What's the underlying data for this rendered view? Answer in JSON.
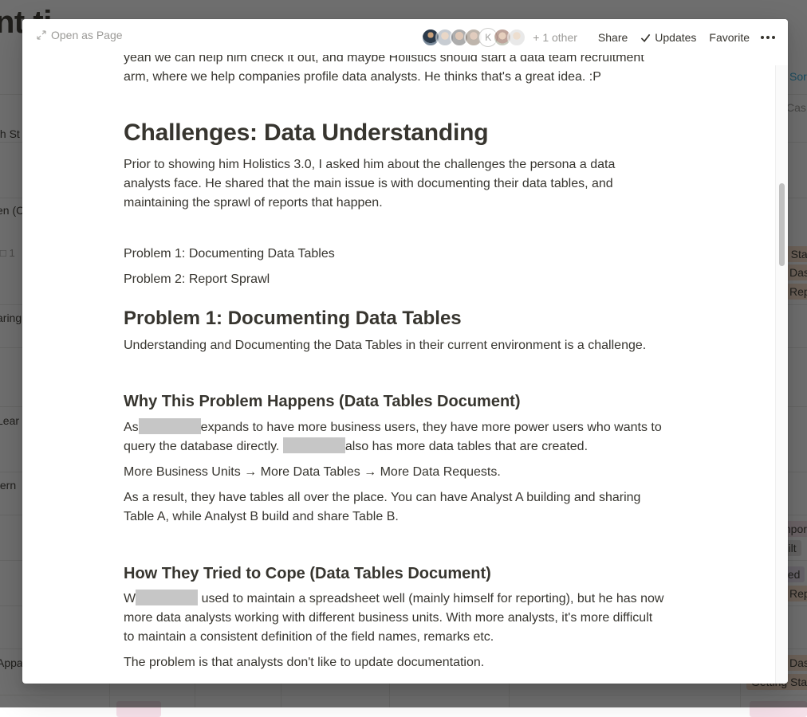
{
  "background_page": {
    "title_fragment": "nt      ti",
    "left_cells": [
      "th St",
      "en (C",
      "aring",
      "Lear",
      "tern",
      "Appa"
    ],
    "comment_count": "1",
    "right_cells": {
      "sort_label": "Sor",
      "case_label": "Cas",
      "tags": [
        "g Sta",
        "Das",
        "Rep",
        "mpor",
        "Filt",
        "ded",
        "Rep",
        "Das",
        "Getting Sta"
      ]
    }
  },
  "modal": {
    "open_as_page_label": "Open as Page",
    "collaborators": {
      "avatars": [
        "avatar-1",
        "avatar-2",
        "avatar-3",
        "avatar-4",
        "K",
        "avatar-6",
        "avatar-7"
      ],
      "others_label": "+ 1 other"
    },
    "actions": {
      "share": "Share",
      "updates": "Updates",
      "favorite": "Favorite"
    },
    "body": {
      "intro_line1": "yeah we can help him check it out, and maybe Holistics should start a data team recruitment",
      "intro_line2": "arm, where we help companies profile data analysts. He thinks that's a great idea. :P",
      "h_challenges": "Challenges: Data Understanding",
      "challenges_p1": "Prior to showing him Holistics 3.0, I asked him about the challenges the persona a data",
      "challenges_p2": "analysts face. He shared that the main issue is with documenting their data tables, and",
      "challenges_p3": "maintaining the sprawl of reports that happen.",
      "problem_list": [
        "Problem 1: Documenting Data Tables",
        "Problem 2: Report Sprawl"
      ],
      "h_problem1": "Problem 1: Documenting Data Tables",
      "problem1_p": "Understanding and Documenting the Data Tables in their current environment is a challenge.",
      "h_why": "Why This Problem Happens (Data Tables Document)",
      "why_p1_a": "As",
      "why_p1_b": "expands to have more business users, they have more power users who wants to",
      "why_p2_a": "query the database directly.",
      "why_p2_b": "also has more data tables that are created.",
      "why_flow": "More Business Units → More Data Tables  → More Data Requests.",
      "why_result1": "As a result, they have tables all over the place. You can have Analyst A building and sharing",
      "why_result2": "Table A, while Analyst B build and share Table B.",
      "h_cope": "How They Tried to Cope (Data Tables Document)",
      "cope_p1_a": "W",
      "cope_p1_b": "used to maintain a spreadsheet well (mainly himself for reporting), but he has now",
      "cope_p2": "more data analysts working with different business units. With more analysts, it's more difficult",
      "cope_p3": "to maintain a consistent definition of the field names, remarks etc.",
      "cope_p4": "The problem is that analysts don't like to update documentation."
    }
  },
  "colors": {
    "text": "#37352f",
    "muted": "#9b9a97",
    "redaction": "#c6c6c6",
    "link_blue": "#2eaadc"
  }
}
